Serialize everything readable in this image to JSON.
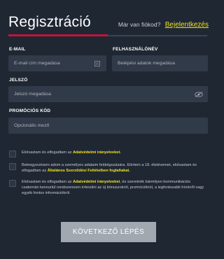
{
  "header": {
    "title": "Regisztráció",
    "login_prompt": "Már van fiókod?",
    "login_link": "Bejelentkezés"
  },
  "form": {
    "email": {
      "label": "E-MAIL",
      "placeholder": "E-mail cím megadása",
      "icon": "contact-card-icon"
    },
    "username": {
      "label": "FELHASZNÁLÓNÉV",
      "placeholder": "Belépési adatok megadása"
    },
    "password": {
      "label": "JELSZÓ",
      "placeholder": "Jelszó megadása",
      "icon": "eye-hidden-icon"
    },
    "promo": {
      "label": "PROMÓCIÓS KÓD",
      "placeholder": "Opcionális mező"
    }
  },
  "consents": [
    {
      "text_before": "Elolvastam és elfogadtam az ",
      "link": "Adatvédelmi irányelveket.",
      "text_after": ""
    },
    {
      "text_before": "Beleegyezésem adom a személyes adataim feldolgozására. Elértem a 18. életévemet, elolvastam és elfogadtam az ",
      "link": "Általános Szerződési Feltételben foglaltakat.",
      "text_after": ""
    },
    {
      "text_before": "Elolvastam és elfogadtam az ",
      "link": "Adatvédelmi irányelveket",
      "text_after": ", és szeretnék bármilyen kommunikációs csatornán keresztül rendszeresen értesülni az új bónuszokról, promóciókról, a legfontosabb hírekről vagy egyéb fontos információkról."
    }
  ],
  "submit_label": "KÖVETKEZŐ LÉPÉS",
  "colors": {
    "background": "#1f2733",
    "field": "#313a48",
    "accent_red": "#c4143b",
    "accent_yellow": "#f2e21c",
    "button": "#a2a8b0"
  }
}
